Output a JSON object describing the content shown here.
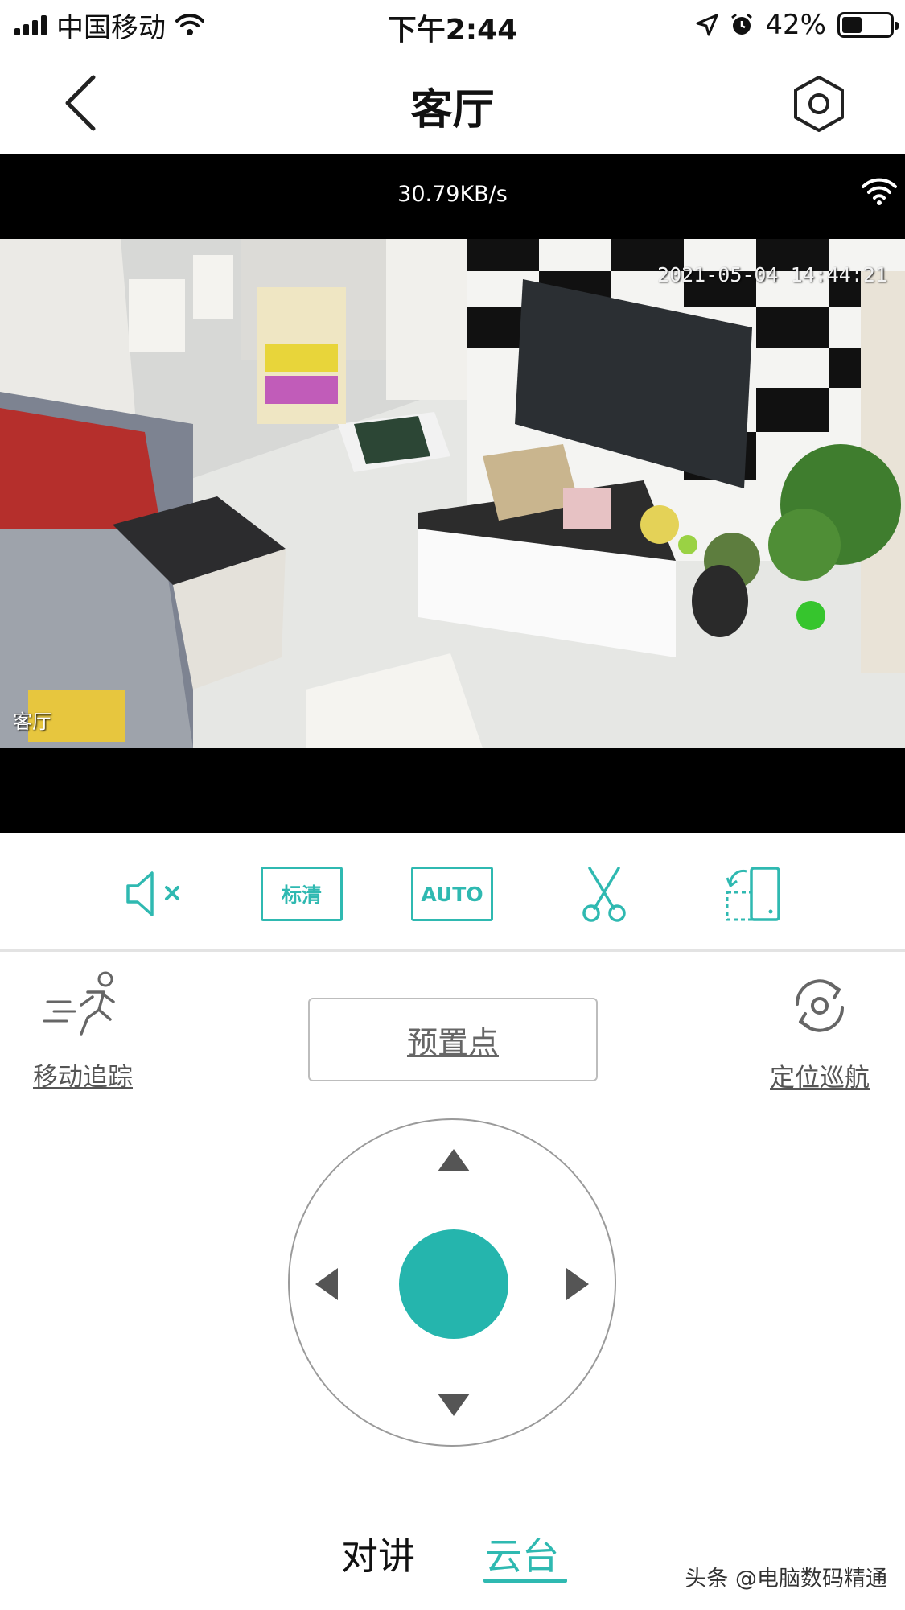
{
  "status_bar": {
    "carrier": "中国移动",
    "time": "下午2:44",
    "battery": "42%",
    "battery_level": 0.42,
    "icons": [
      "signal-icon",
      "wifi-icon",
      "location-icon",
      "alarm-icon",
      "battery-icon"
    ]
  },
  "nav": {
    "title": "客厅",
    "back_icon": "chevron-left-icon",
    "settings_icon": "gear-icon"
  },
  "video": {
    "speed": "30.79KB/s",
    "timestamp": "2021-05-04 14:44:21",
    "camera_label": "客厅"
  },
  "toolbar": {
    "mute_icon": "speaker-mute-icon",
    "quality": "标清",
    "mode": "AUTO",
    "snapshot_icon": "scissors-icon",
    "rotate_icon": "rotate-screen-icon"
  },
  "ptz": {
    "motion_tracking": "移动追踪",
    "preset": "预置点",
    "cruise": "定位巡航"
  },
  "tabs": {
    "talk": "对讲",
    "ptz": "云台",
    "active": "云台"
  },
  "watermark": "头条 @电脑数码精通",
  "colors": {
    "accent": "#2fb9b1",
    "video_bg": "#000000"
  }
}
